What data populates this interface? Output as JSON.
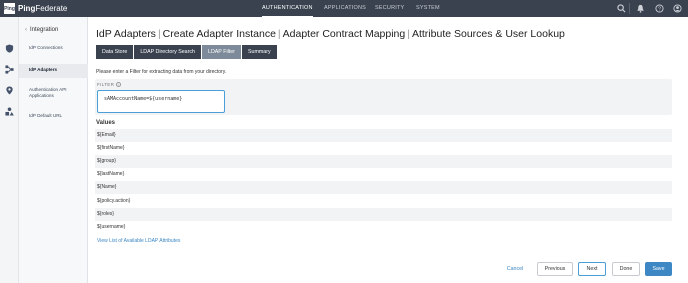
{
  "app": {
    "logo_mark": "Ping",
    "logo_brand": "Ping",
    "logo_product": "Federate"
  },
  "topnav": {
    "items": [
      "AUTHENTICATION",
      "APPLICATIONS",
      "SECURITY",
      "SYSTEM"
    ],
    "active": "AUTHENTICATION"
  },
  "topicons": [
    "search-icon",
    "bell-icon",
    "help-icon",
    "user-icon"
  ],
  "sidebar": {
    "section": "Integration",
    "items": [
      {
        "label": "IdP Connections"
      },
      {
        "label": "IdP Adapters"
      },
      {
        "label": "Authentication API Applications"
      },
      {
        "label": "IdP Default URL"
      }
    ],
    "active_index": 1
  },
  "page": {
    "title_parts": [
      "IdP Adapters",
      "Create Adapter Instance",
      "Adapter Contract Mapping",
      "Attribute Sources & User Lookup"
    ],
    "separator": "|"
  },
  "tabs": [
    {
      "label": "Data Store"
    },
    {
      "label": "LDAP Directory Search"
    },
    {
      "label": "LDAP Filter"
    },
    {
      "label": "Summary"
    }
  ],
  "active_tab": 2,
  "instructions": "Please enter a Filter for extracting data from your directory.",
  "filter": {
    "label": "FILTER",
    "value": "sAMAccountName=${username}"
  },
  "values": {
    "heading": "Values",
    "items": [
      "${Email}",
      "${firstName}",
      "${group}",
      "${lastName}",
      "${Name}",
      "${policy.action}",
      "${roles}",
      "${username}"
    ]
  },
  "view_link": "View List of Available LDAP Attributes",
  "footer": {
    "cancel": "Cancel",
    "previous": "Previous",
    "next": "Next",
    "done": "Done",
    "save": "Save"
  },
  "colors": {
    "topbar": "#3a4250",
    "accent": "#3d87c4",
    "active_tab": "#7d8a99"
  }
}
